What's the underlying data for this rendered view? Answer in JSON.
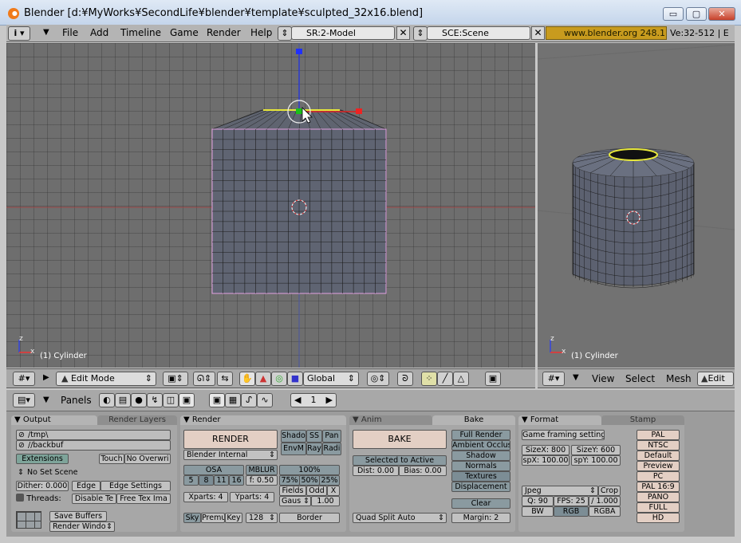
{
  "window": {
    "title": "Blender [d:¥MyWorks¥SecondLife¥blender¥template¥sculpted_32x16.blend]",
    "min_label": "▭",
    "max_label": "▢",
    "close_label": "✕"
  },
  "menubar": {
    "items": [
      "File",
      "Add",
      "Timeline",
      "Game",
      "Render",
      "Help"
    ],
    "screen": "SR:2-Model",
    "scene": "SCE:Scene",
    "link": "www.blender.org 248.1",
    "stats": "Ve:32-512 | E"
  },
  "viewport_left": {
    "object_label": "(1) Cylinder",
    "axis_z": "z",
    "axis_x": "x"
  },
  "viewport_right": {
    "object_label": "(1) Cylinder",
    "axis_z": "z",
    "axis_x": "x"
  },
  "header_left": {
    "mode": "Edit Mode",
    "orientation": "Global"
  },
  "header_right": {
    "menus": [
      "View",
      "Select",
      "Mesh"
    ],
    "mode": "Edit"
  },
  "buttons_header": {
    "panels_label": "Panels",
    "frame": "1"
  },
  "output_panel": {
    "tab1": "Output",
    "tab2": "Render Layers",
    "path1": "/tmp\\",
    "path2": "//backbuf",
    "extensions": "Extensions",
    "touch": "Touch",
    "no_overwrite": "No Overwri",
    "no_set_scene": "No Set Scene",
    "dither": "Dither: 0.000",
    "edge": "Edge",
    "edge_settings": "Edge Settings",
    "threads": "Threads:",
    "disable_tex": "Disable Te",
    "free_tex": "Free Tex Ima",
    "save_buffers": "Save Buffers",
    "render_window": "Render Windo"
  },
  "render_panel": {
    "tab": "Render",
    "render": "RENDER",
    "engine": "Blender Internal",
    "shadow": "Shado",
    "ss": "SS",
    "pan": "Pan",
    "envmap": "EnvM",
    "ray": "Ray",
    "radio": "Radi",
    "osa": "OSA",
    "osa_values": [
      "5",
      "8",
      "11",
      "16"
    ],
    "mblur": "MBLUR",
    "mblur_f": "f: 0.50",
    "percent_title": "100%",
    "percent_values": [
      "75%",
      "50%",
      "25%"
    ],
    "xparts": "Xparts: 4",
    "yparts": "Yparts: 4",
    "fields": "Fields",
    "odd": "Odd",
    "x": "X",
    "gauss": "Gaus",
    "gauss_val": "1.00",
    "sky": "Sky",
    "premul": "Premu",
    "key": "Key",
    "bits": "128",
    "border": "Border"
  },
  "bake_panel": {
    "tab1": "Anim",
    "tab2": "Bake",
    "bake": "BAKE",
    "selected_to_active": "Selected to Active",
    "dist": "Dist: 0.00",
    "bias": "Bias: 0.00",
    "split": "Quad Split Auto",
    "options": [
      "Full Render",
      "Ambient Occlus",
      "Shadow",
      "Normals",
      "Textures",
      "Displacement"
    ],
    "clear": "Clear",
    "margin": "Margin: 2"
  },
  "format_panel": {
    "tab1": "Format",
    "tab2": "Stamp",
    "game_framing": "Game framing settings",
    "sizex": "SizeX: 800",
    "sizey": "SizeY: 600",
    "aspx": "spX: 100.00",
    "aspy": "spY: 100.00",
    "file_type": "Jpeg",
    "crop": "Crop",
    "quality": "Q: 90",
    "fps": "FPS: 25",
    "fps_base": "/ 1.000",
    "bw": "BW",
    "rgb": "RGB",
    "rgba": "RGBA",
    "presets": [
      "PAL",
      "NTSC",
      "Default",
      "Preview",
      "PC",
      "PAL 16:9",
      "PANO",
      "FULL",
      "HD"
    ]
  }
}
